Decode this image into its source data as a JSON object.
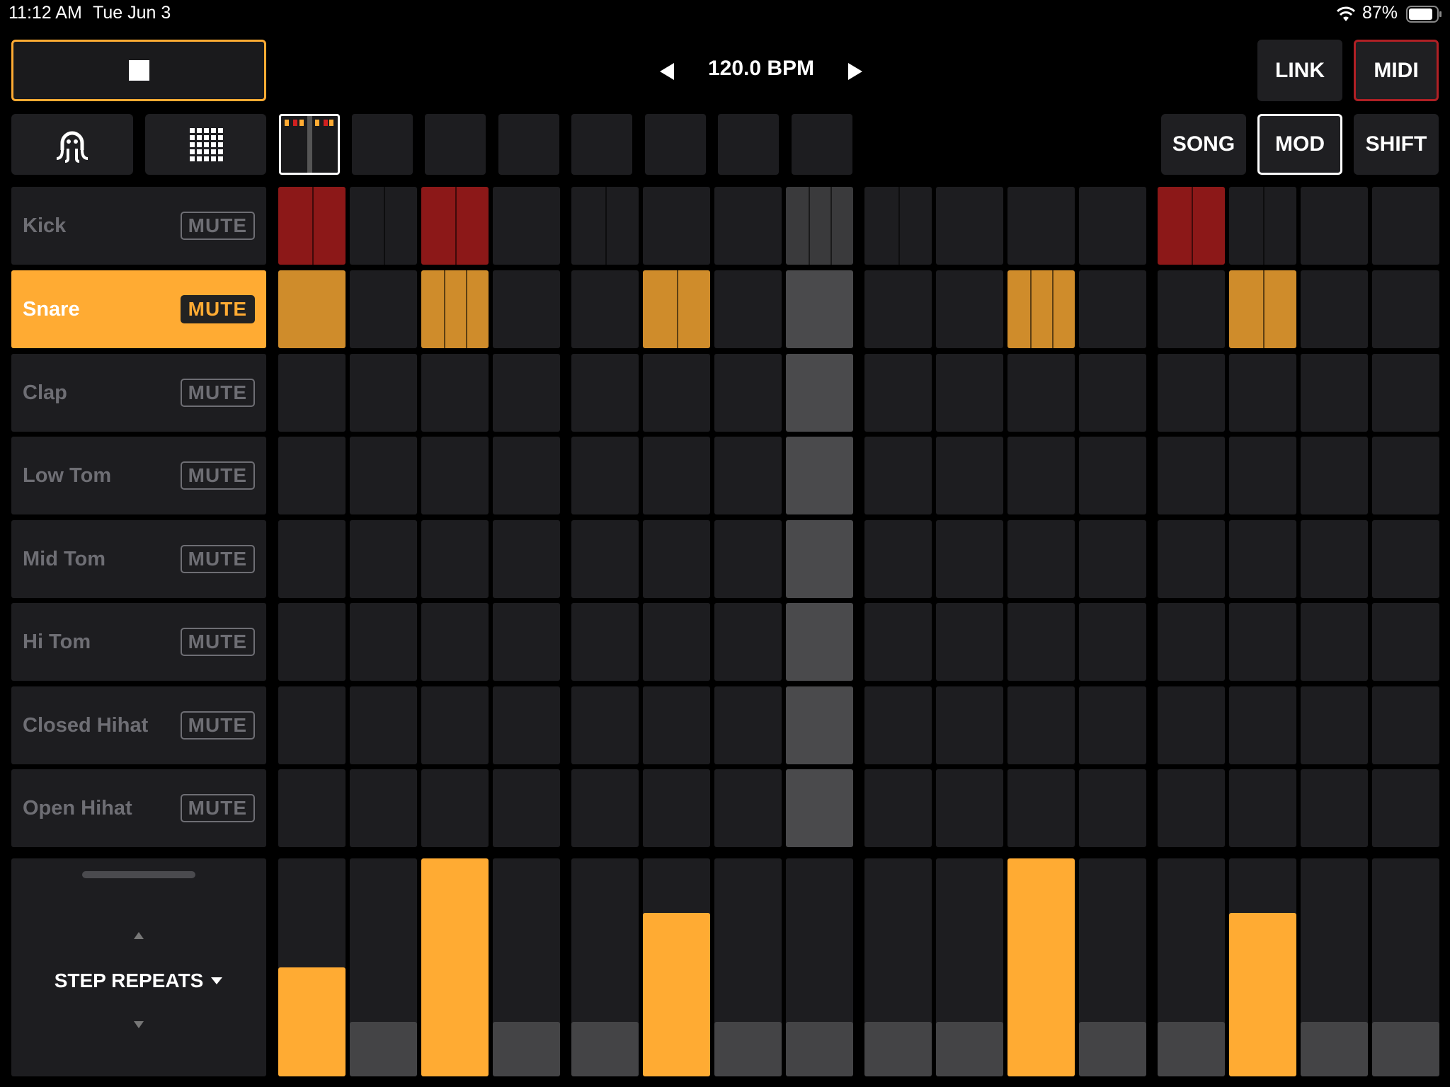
{
  "status_bar": {
    "time": "11:12 AM",
    "date": "Tue Jun 3",
    "battery": "87%"
  },
  "transport": {
    "tempo": "120.0 BPM",
    "prev_icon": "triangle-left-icon",
    "next_icon": "triangle-right-icon"
  },
  "top_right": {
    "link_label": "LINK",
    "midi_label": "MIDI"
  },
  "modes": {
    "song_label": "SONG",
    "mod_label": "MOD",
    "shift_label": "SHIFT"
  },
  "colors": {
    "accent": "#ffab33",
    "kick": "#8c1818",
    "snare": "#cf8c2b",
    "midi_border": "#b02025"
  },
  "tracks": [
    {
      "name": "Kick",
      "mute": "MUTE"
    },
    {
      "name": "Snare",
      "mute": "MUTE"
    },
    {
      "name": "Clap",
      "mute": "MUTE"
    },
    {
      "name": "Low Tom",
      "mute": "MUTE"
    },
    {
      "name": "Mid Tom",
      "mute": "MUTE"
    },
    {
      "name": "Hi Tom",
      "mute": "MUTE"
    },
    {
      "name": "Closed Hihat",
      "mute": "MUTE"
    },
    {
      "name": "Open Hihat",
      "mute": "MUTE"
    }
  ],
  "selected_track": 1,
  "current_step": 7,
  "pattern_slots": 8,
  "kick_steps": [
    2,
    1,
    2,
    0,
    1,
    0,
    0,
    3,
    1,
    0,
    0,
    0,
    2,
    1,
    0,
    0
  ],
  "snare_steps": [
    1,
    0,
    3,
    0,
    0,
    2,
    0,
    0,
    0,
    0,
    3,
    0,
    0,
    2,
    0,
    0
  ],
  "step_repeats": {
    "label": "STEP REPEATS",
    "values": [
      1,
      0,
      3,
      0,
      0,
      2,
      0,
      0,
      0,
      0,
      3,
      0,
      0,
      2,
      0,
      0
    ]
  }
}
